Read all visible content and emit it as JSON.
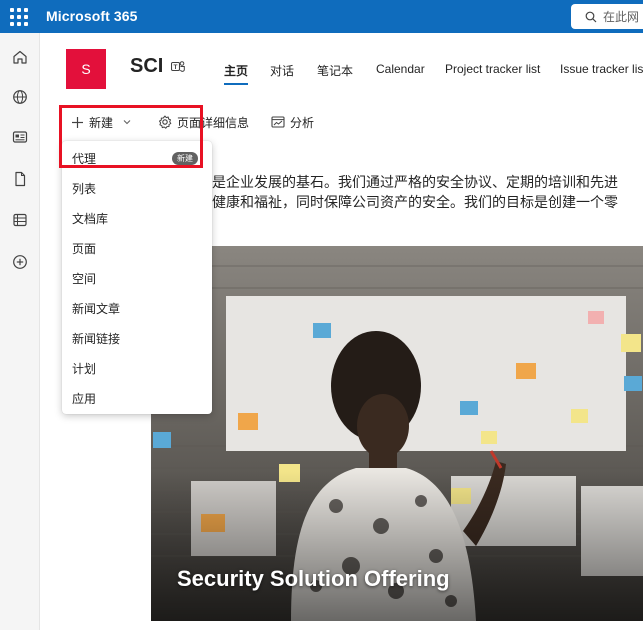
{
  "suite": {
    "app_name": "Microsoft 365",
    "search_placeholder": "在此网"
  },
  "rail": {
    "icons": [
      "home-icon",
      "globe-icon",
      "news-icon",
      "file-icon",
      "list-icon",
      "add-circle-icon"
    ]
  },
  "site": {
    "logo_letter": "S",
    "name": "SCI",
    "nav": [
      "主页",
      "对话",
      "笔记本",
      "Calendar",
      "Project tracker list",
      "Issue tracker list"
    ],
    "active_nav": "主页"
  },
  "commands": {
    "new_label": "新建",
    "page_details_label": "页面详细信息",
    "analytics_label": "分析"
  },
  "new_menu": {
    "items": [
      "代理",
      "列表",
      "文档库",
      "页面",
      "空间",
      "新闻文章",
      "新闻链接",
      "计划",
      "应用"
    ],
    "new_badge": "新建"
  },
  "intro_lines": [
    "是企业发展的基石。我们通过严格的安全协议、定期的培训和先进",
    "健康和福祉，同时保障公司资产的安全。我们的目标是创建一个零"
  ],
  "hero": {
    "title": "Security Solution Offering"
  },
  "colors": {
    "suite_bar": "#0f6cbd",
    "site_logo": "#e3103b",
    "highlight": "#e81123"
  }
}
